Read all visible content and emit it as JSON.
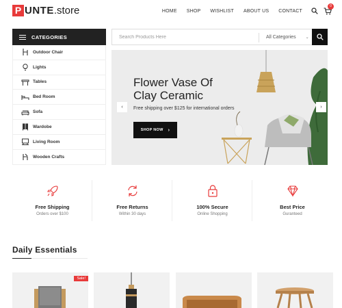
{
  "header": {
    "logo_letter": "P",
    "logo_text": "UNTE",
    "logo_suffix": ".store",
    "nav": [
      "HOME",
      "SHOP",
      "WISHLIST",
      "ABOUT US",
      "CONTACT"
    ],
    "cart_count": "0"
  },
  "categories": {
    "title": "CATEGORIES",
    "items": [
      {
        "label": "Outdoor Chair",
        "icon": "chair-icon"
      },
      {
        "label": "Lights",
        "icon": "bulb-icon"
      },
      {
        "label": "Tables",
        "icon": "table-icon"
      },
      {
        "label": "Bed Room",
        "icon": "bed-icon"
      },
      {
        "label": "Sofa",
        "icon": "sofa-icon"
      },
      {
        "label": "Wardobe",
        "icon": "wardrobe-icon"
      },
      {
        "label": "Living Room",
        "icon": "living-room-icon"
      },
      {
        "label": "Wooden Crafts",
        "icon": "wooden-craft-icon"
      }
    ]
  },
  "search": {
    "placeholder": "Search Products Here",
    "category_selected": "All Categories"
  },
  "hero": {
    "title": "Flower Vase Of Clay Ceramic",
    "subtitle": "Free shipping over $125 for international orders",
    "button": "SHOP NOW"
  },
  "features": [
    {
      "title": "Free Shipping",
      "subtitle": "Orders over $100",
      "icon": "rocket-icon"
    },
    {
      "title": "Free Returns",
      "subtitle": "Within 30 days",
      "icon": "refresh-icon"
    },
    {
      "title": "100% Secure",
      "subtitle": "Online Shopping",
      "icon": "lock-icon"
    },
    {
      "title": "Best Price",
      "subtitle": "Guranteed",
      "icon": "diamond-icon"
    }
  ],
  "section": {
    "title": "Daily Essentials"
  },
  "products": [
    {
      "badge": "Sale!",
      "icon": "armchair-icon"
    },
    {
      "icon": "pendant-lamp-icon"
    },
    {
      "icon": "side-table-icon"
    },
    {
      "icon": "stool-icon"
    }
  ],
  "colors": {
    "accent": "#e83a3a",
    "dark": "#111111",
    "hero_bg": "#ececec"
  }
}
